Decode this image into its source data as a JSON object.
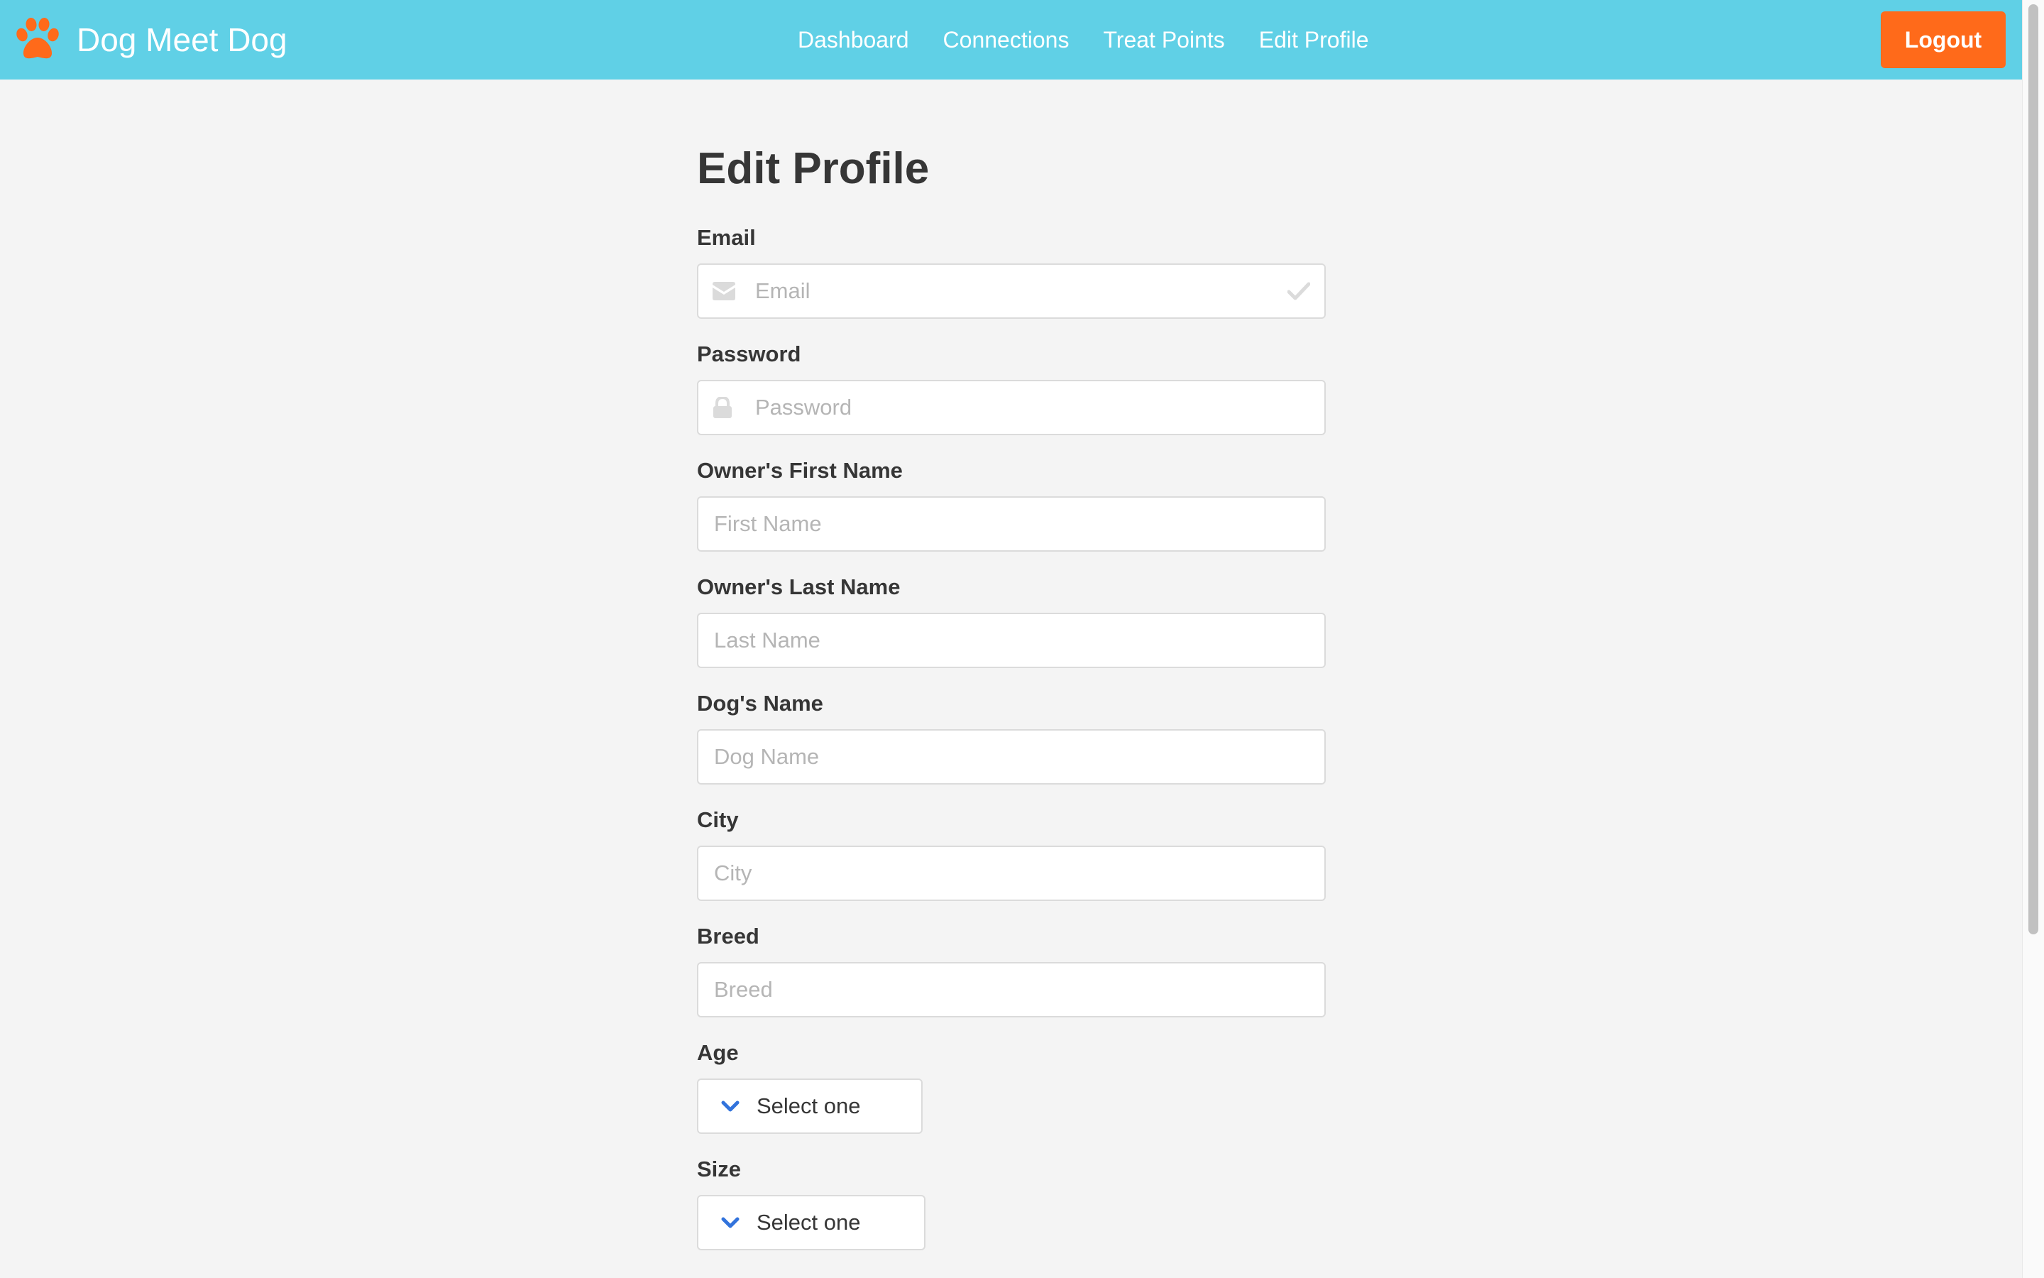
{
  "app": {
    "brand": "Dog Meet Dog",
    "icon": "paw-icon",
    "colors": {
      "navbar": "#60d0e6",
      "accent": "#ff6a1a",
      "chevron": "#3273dc"
    }
  },
  "nav": {
    "links": [
      "Dashboard",
      "Connections",
      "Treat Points",
      "Edit Profile"
    ],
    "logout_label": "Logout"
  },
  "page": {
    "title": "Edit Profile"
  },
  "form": {
    "email": {
      "label": "Email",
      "placeholder": "Email",
      "value": "",
      "icon_left": "envelope-icon",
      "icon_right": "check-icon"
    },
    "password": {
      "label": "Password",
      "placeholder": "Password",
      "value": "",
      "icon_left": "lock-icon"
    },
    "first_name": {
      "label": "Owner's First Name",
      "placeholder": "First Name",
      "value": ""
    },
    "last_name": {
      "label": "Owner's Last Name",
      "placeholder": "Last Name",
      "value": ""
    },
    "dog_name": {
      "label": "Dog's Name",
      "placeholder": "Dog Name",
      "value": ""
    },
    "city": {
      "label": "City",
      "placeholder": "City",
      "value": ""
    },
    "breed": {
      "label": "Breed",
      "placeholder": "Breed",
      "value": ""
    },
    "age": {
      "label": "Age",
      "selected": "Select one",
      "icon": "chevron-down-icon"
    },
    "size": {
      "label": "Size",
      "selected": "Select one",
      "icon": "chevron-down-icon"
    }
  }
}
